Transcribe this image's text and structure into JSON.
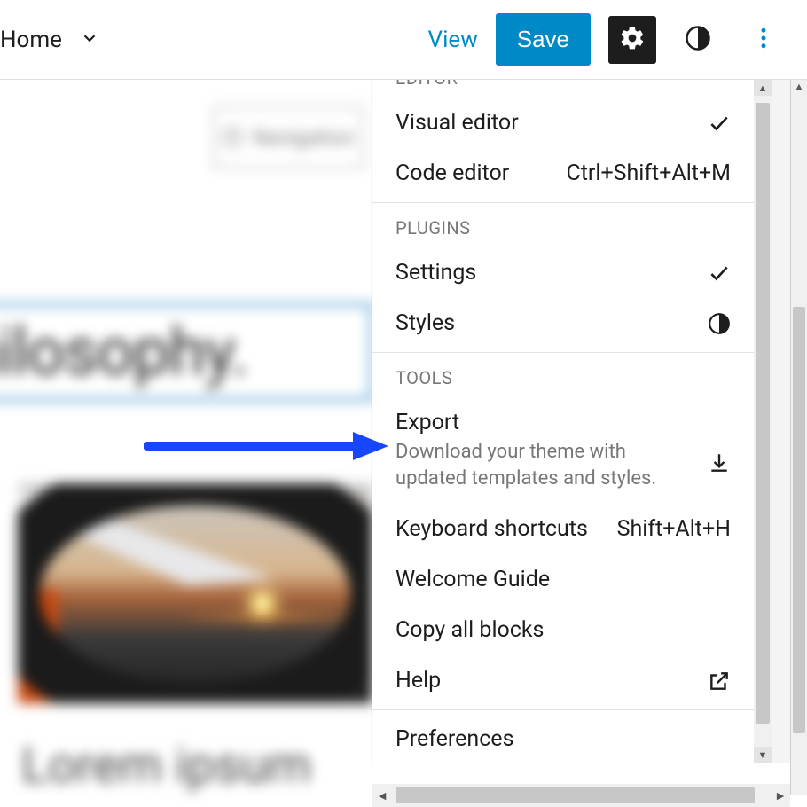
{
  "topbar": {
    "home": "Home",
    "view": "View",
    "save": "Save"
  },
  "canvas": {
    "nav_chip": "Navigation",
    "headline": "hilosophy.",
    "lorem": "Lorem ipsum"
  },
  "menu": {
    "sections": {
      "editor": "Editor",
      "plugins": "Plugins",
      "tools": "Tools"
    },
    "items": {
      "visual_editor": "Visual editor",
      "code_editor": {
        "label": "Code editor",
        "shortcut": "Ctrl+Shift+Alt+M"
      },
      "settings": "Settings",
      "styles": "Styles",
      "export": {
        "label": "Export",
        "desc": "Download your theme with updated templates and styles."
      },
      "keyboard": {
        "label": "Keyboard shortcuts",
        "shortcut": "Shift+Alt+H"
      },
      "welcome": "Welcome Guide",
      "copy_all": "Copy all blocks",
      "help": "Help",
      "preferences": "Preferences"
    }
  }
}
